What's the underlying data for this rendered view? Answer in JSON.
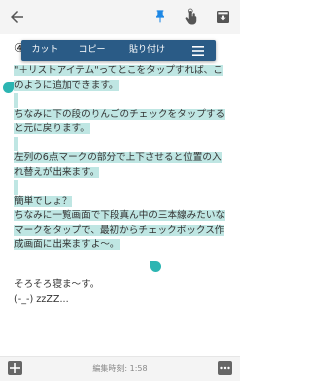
{
  "popup": {
    "cut": "カット",
    "copy": "コピー",
    "paste": "貼り付け"
  },
  "note": {
    "line_partial": "④",
    "paragraphs": [
      "\"＋リストアイテム\"ってとこをタップすれば、このように追加できます。",
      "ちなみに下の段のりんごのチェックをタップすると元に戻ります。",
      "左列の6点マークの部分で上下させると位置の入れ替えが出来ます。",
      "簡単でしょ？\nちなみに一覧画面で下段真ん中の三本線みたいなマークをタップで、最初からチェックボックス作成画面に出来ますよ〜。"
    ],
    "after_1": "そろそろ寝ま〜す。",
    "after_2": "(-_-) zzZZ..."
  },
  "bottom": {
    "edit_time": "編集時刻: 1:58"
  },
  "colors": {
    "accent": "#2cb5b2",
    "selection": "#bfe6e3",
    "popup": "#2a5b86",
    "pin": "#1e88e5"
  }
}
